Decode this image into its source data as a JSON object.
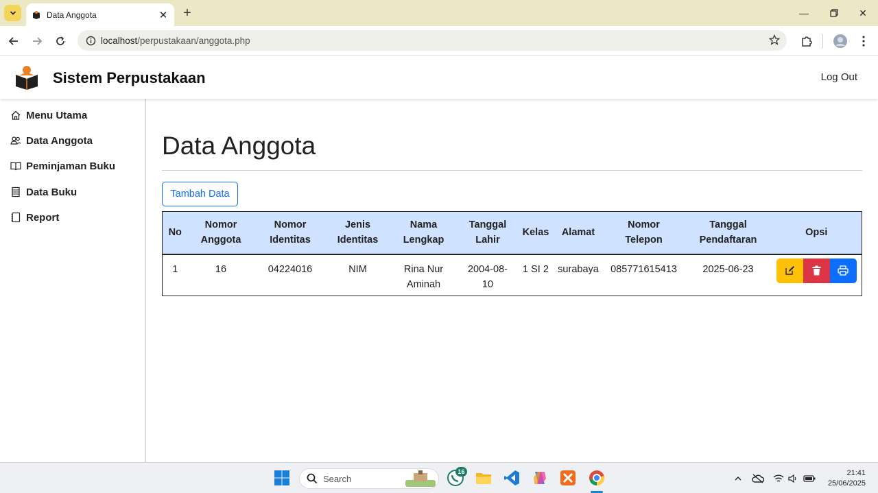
{
  "browser": {
    "tab_title": "Data Anggota",
    "url_host": "localhost",
    "url_path": "/perpustakaan/anggota.php"
  },
  "header": {
    "brand": "Sistem Perpustakaan",
    "logout": "Log Out"
  },
  "sidebar": {
    "items": [
      {
        "label": "Menu Utama",
        "icon": "home-icon"
      },
      {
        "label": "Data Anggota",
        "icon": "people-icon"
      },
      {
        "label": "Peminjaman Buku",
        "icon": "book-open-icon"
      },
      {
        "label": "Data Buku",
        "icon": "book-list-icon"
      },
      {
        "label": "Report",
        "icon": "journal-icon"
      }
    ]
  },
  "main": {
    "title": "Data Anggota",
    "add_button": "Tambah Data",
    "table": {
      "headers": [
        [
          "No"
        ],
        [
          "Nomor",
          "Anggota"
        ],
        [
          "Nomor",
          "Identitas"
        ],
        [
          "Jenis",
          "Identitas"
        ],
        [
          "Nama",
          "Lengkap"
        ],
        [
          "Tanggal",
          "Lahir"
        ],
        [
          "Kelas"
        ],
        [
          "Alamat"
        ],
        [
          "Nomor",
          "Telepon"
        ],
        [
          "Tanggal",
          "Pendaftaran"
        ],
        [
          "Opsi"
        ]
      ],
      "rows": [
        {
          "no": "1",
          "nomor_anggota": "16",
          "nomor_identitas": "04224016",
          "jenis_identitas": "NIM",
          "nama_lengkap": "Rina Nur Aminah",
          "tanggal_lahir": "2004-08-10",
          "kelas": "1 SI 2",
          "alamat": "surabaya",
          "nomor_telepon": "085771615413",
          "tanggal_pendaftaran": "2025-06-23"
        }
      ]
    }
  },
  "taskbar": {
    "search_placeholder": "Search",
    "whatsapp_badge": "16",
    "time": "21:41",
    "date": "25/06/2025"
  },
  "colors": {
    "tabbar": "#ece7c5",
    "table_header": "#cfe2ff",
    "primary": "#0d6efd",
    "warning": "#ffc107",
    "danger": "#dc3545"
  }
}
